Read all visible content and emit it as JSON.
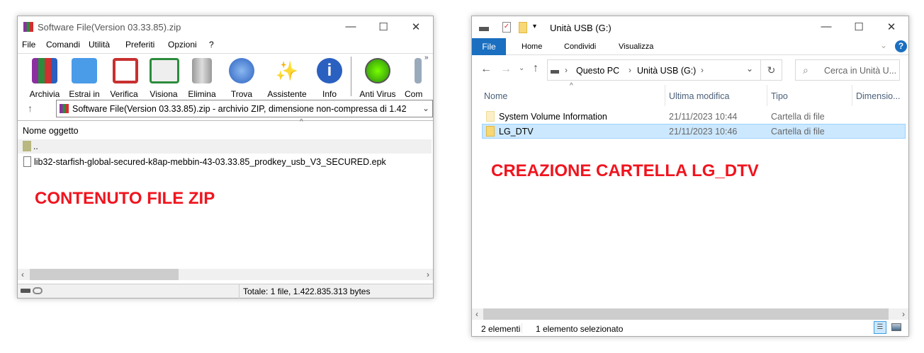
{
  "winrar": {
    "title": "Software File(Version 03.33.85).zip",
    "menu": [
      "File",
      "Comandi",
      "Utilità",
      "Preferiti",
      "Opzioni",
      "?"
    ],
    "toolbar": [
      "Archivia",
      "Estrai in",
      "Verifica",
      "Visiona",
      "Elimina",
      "Trova",
      "Assistente",
      "Info",
      "Anti Virus",
      "Com"
    ],
    "address": "Software File(Version 03.33.85).zip - archivio ZIP, dimensione non-compressa di 1.42",
    "column": "Nome oggetto",
    "rows": [
      "..",
      "lib32-starfish-global-secured-k8ap-mebbin-43-03.33.85_prodkey_usb_V3_SECURED.epk"
    ],
    "annotation": "CONTENUTO FILE ZIP",
    "status": "Totale: 1 file, 1.422.835.313 bytes"
  },
  "explorer": {
    "title": "Unità USB (G:)",
    "tabs": [
      "File",
      "Home",
      "Condividi",
      "Visualizza"
    ],
    "breadcrumb": [
      "Questo PC",
      "Unità USB (G:)"
    ],
    "search_placeholder": "Cerca in Unità U...",
    "columns": [
      "Nome",
      "Ultima modifica",
      "Tipo",
      "Dimensio..."
    ],
    "rows": [
      {
        "name": "System Volume Information",
        "date": "21/11/2023 10:44",
        "type": "Cartella di file"
      },
      {
        "name": "LG_DTV",
        "date": "21/11/2023 10:46",
        "type": "Cartella di file"
      }
    ],
    "annotation": "CREAZIONE CARTELLA LG_DTV",
    "status_count": "2 elementi",
    "status_selected": "1 elemento selezionato"
  },
  "colors": {
    "accent": "#1a6fc0",
    "selection": "#cce8ff",
    "annotation": "#f0141e"
  }
}
